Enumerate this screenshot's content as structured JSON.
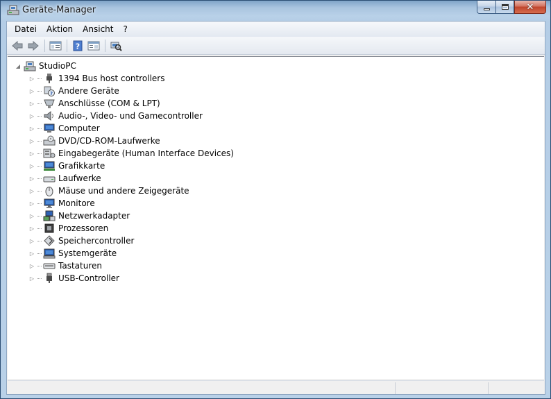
{
  "window": {
    "title": "Geräte-Manager",
    "close_glyph": "✕"
  },
  "menu": [
    "Datei",
    "Aktion",
    "Ansicht",
    "?"
  ],
  "toolbar": {
    "buttons": [
      "back-arrow-icon",
      "forward-arrow-icon",
      "show-hide-console-tree-icon",
      "help-icon",
      "properties-view-icon",
      "scan-hardware-icon"
    ]
  },
  "tree": {
    "root": "StudioPC",
    "root_expander": "◢",
    "expander_collapsed": "▷",
    "items": [
      {
        "label": "1394 Bus host controllers",
        "icon": "firewire-icon"
      },
      {
        "label": "Andere Geräte",
        "icon": "unknown-device-icon"
      },
      {
        "label": "Anschlüsse (COM & LPT)",
        "icon": "port-icon"
      },
      {
        "label": "Audio-, Video- und Gamecontroller",
        "icon": "speaker-icon"
      },
      {
        "label": "Computer",
        "icon": "computer-icon"
      },
      {
        "label": "DVD/CD-ROM-Laufwerke",
        "icon": "optical-drive-icon"
      },
      {
        "label": "Eingabegeräte (Human Interface Devices)",
        "icon": "hid-icon"
      },
      {
        "label": "Grafikkarte",
        "icon": "display-adapter-icon"
      },
      {
        "label": "Laufwerke",
        "icon": "disk-drive-icon"
      },
      {
        "label": "Mäuse und andere Zeigegeräte",
        "icon": "mouse-icon"
      },
      {
        "label": "Monitore",
        "icon": "monitor-icon"
      },
      {
        "label": "Netzwerkadapter",
        "icon": "network-adapter-icon"
      },
      {
        "label": "Prozessoren",
        "icon": "processor-icon"
      },
      {
        "label": "Speichercontroller",
        "icon": "storage-controller-icon"
      },
      {
        "label": "Systemgeräte",
        "icon": "system-devices-icon"
      },
      {
        "label": "Tastaturen",
        "icon": "keyboard-icon"
      },
      {
        "label": "USB-Controller",
        "icon": "usb-icon"
      }
    ]
  }
}
